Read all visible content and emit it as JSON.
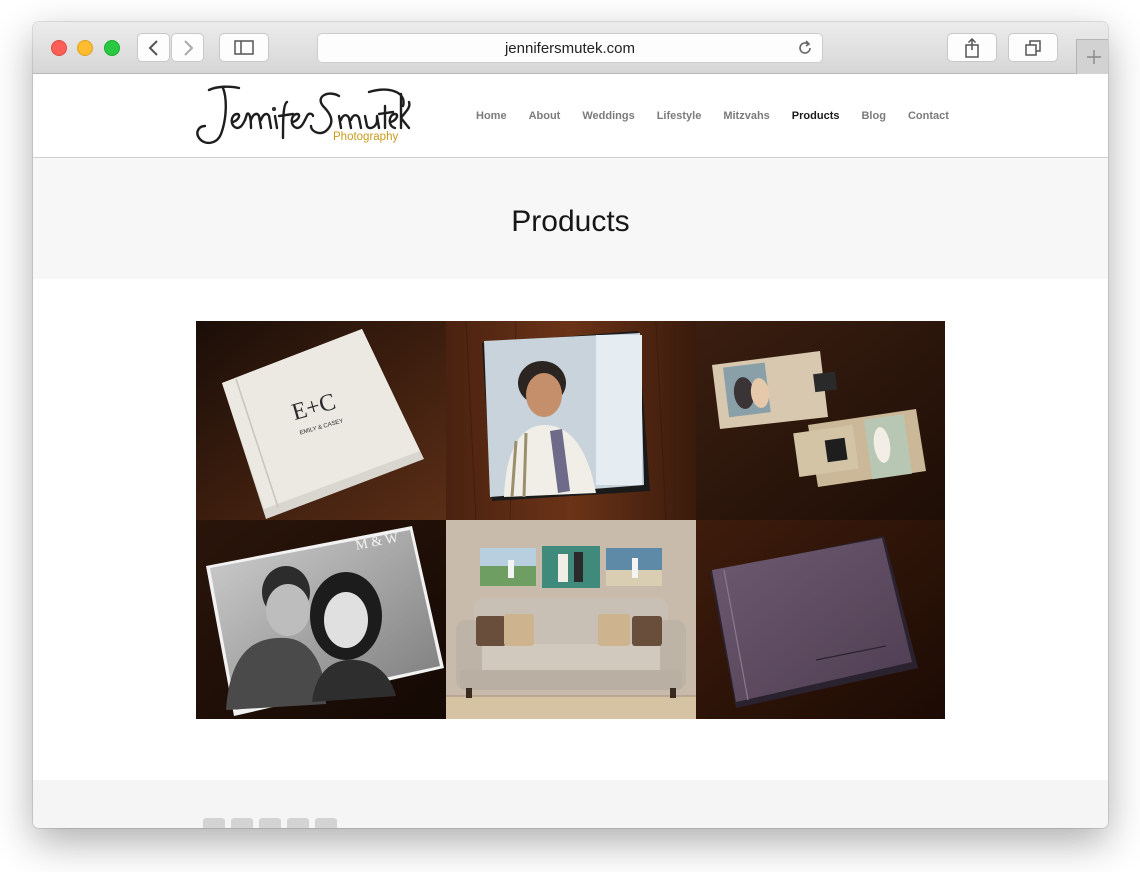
{
  "browser": {
    "url": "jennifersmutek.com",
    "icons": [
      "back-icon",
      "forward-icon",
      "sidebar-icon",
      "reload-icon",
      "share-icon",
      "tabs-icon",
      "new-tab-icon"
    ]
  },
  "site": {
    "logo_script": "Jennifer Smutek",
    "logo_sub": "Photography",
    "nav": [
      {
        "label": "Home"
      },
      {
        "label": "About"
      },
      {
        "label": "Weddings"
      },
      {
        "label": "Lifestyle"
      },
      {
        "label": "Mitzvahs"
      },
      {
        "label": "Products",
        "active": true
      },
      {
        "label": "Blog"
      },
      {
        "label": "Contact"
      }
    ]
  },
  "page": {
    "title": "Products"
  },
  "gallery": {
    "album1_monogram": "E+C",
    "album1_names": "EMILY & CASEY",
    "album4_monogram": "M & W"
  },
  "colors": {
    "accent_gold": "#c99a1a",
    "nav_active": "#1a1a1a",
    "nav_inactive": "#7b7b7b"
  },
  "footer": {
    "social_icons": [
      "facebook-icon",
      "google-plus-icon",
      "pinterest-icon",
      "twitter-icon",
      "instagram-icon"
    ]
  }
}
